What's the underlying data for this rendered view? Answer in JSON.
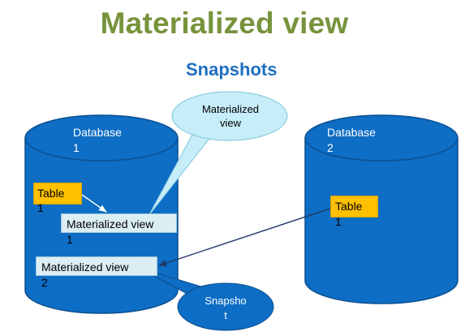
{
  "title": "Materialized view",
  "subtitle": "Snapshots",
  "database_1": {
    "label": "Database",
    "number": "1",
    "table": {
      "label": "Table",
      "number": "1"
    },
    "mv_1": {
      "label": "Materialized view",
      "number": "1"
    },
    "mv_2": {
      "label": "Materialized view",
      "number": "2"
    }
  },
  "database_2": {
    "label": "Database",
    "number": "2",
    "table": {
      "label": "Table",
      "number": "1"
    }
  },
  "callouts": {
    "materialized_view": {
      "line1": "Materialized",
      "line2": "view"
    },
    "snapshot": {
      "line1": "Snapsho",
      "line2": "t"
    }
  },
  "colors": {
    "title_green": "#77933C",
    "subtitle_blue": "#1F6FC0",
    "cylinder_blue": "#0E6DC4",
    "cylinder_outline": "#0A4F8F",
    "table_orange": "#FFC000",
    "mv_light_blue": "#DBEEF4",
    "callout_light": "#C6EDF8",
    "callout_dark": "#0E6DC4"
  }
}
